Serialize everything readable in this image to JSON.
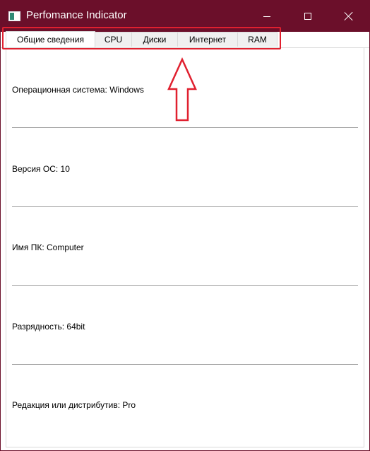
{
  "window": {
    "title": "Perfomance Indicator",
    "accent_color": "#6b0f2a",
    "controls": [
      "minimize-icon",
      "maximize-icon",
      "close-icon"
    ]
  },
  "tabs": [
    {
      "label": "Общие сведения",
      "active": true
    },
    {
      "label": "CPU",
      "active": false
    },
    {
      "label": "Диски",
      "active": false
    },
    {
      "label": "Интернет",
      "active": false
    },
    {
      "label": "RAM",
      "active": false
    }
  ],
  "annotation": {
    "highlight_color": "#e0202f",
    "shapes": [
      "highlight-rectangle",
      "up-arrow"
    ]
  },
  "info": [
    {
      "label": "Операционная система",
      "value": "Windows",
      "text": "Операционная система: Windows"
    },
    {
      "label": "Версия ОС",
      "value": "10",
      "text": "Версия ОС: 10"
    },
    {
      "label": "Имя ПК",
      "value": "Computer",
      "text": "Имя ПК: Computer"
    },
    {
      "label": "Разрядность",
      "value": "64bit",
      "text": "Разрядность: 64bit"
    },
    {
      "label": "Редакция или дистрибутив",
      "value": "Pro",
      "text": "Редакция или дистрибутив: Pro"
    }
  ]
}
